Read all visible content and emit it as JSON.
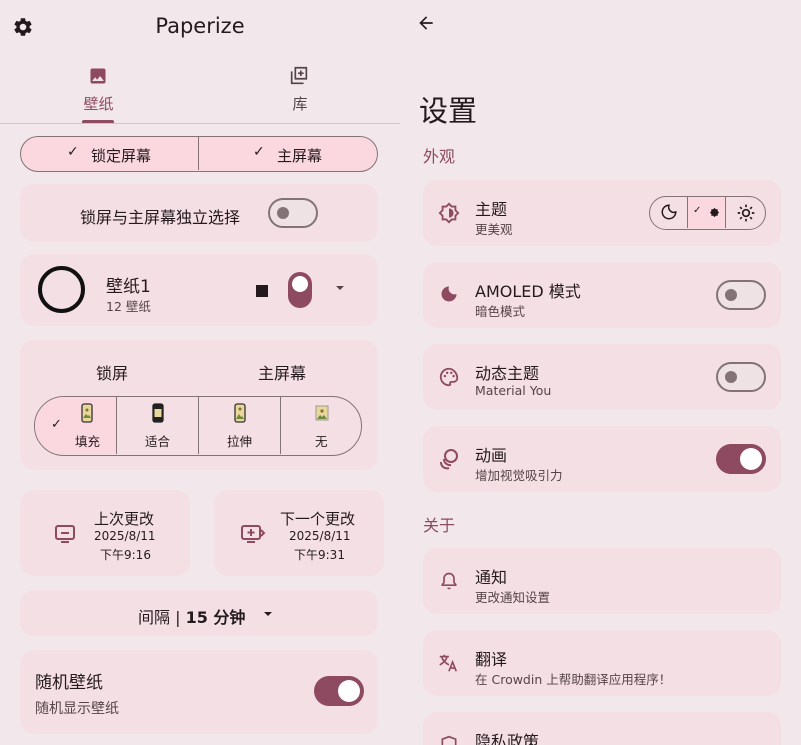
{
  "left": {
    "header": {
      "title": "Paperize",
      "settings_icon": "gear-icon"
    },
    "tabs": [
      {
        "label": "壁纸",
        "icon": "image-icon",
        "selected": true
      },
      {
        "label": "库",
        "icon": "library-add-icon",
        "selected": false
      }
    ],
    "screen_segment": [
      {
        "label": "锁定屏幕",
        "checked": true
      },
      {
        "label": "主屏幕",
        "checked": true
      }
    ],
    "independent": {
      "label": "锁屏与主屏幕独立选择",
      "on": false
    },
    "album": {
      "name": "壁纸1",
      "count": "12 壁纸"
    },
    "scaling": {
      "lock_label": "锁屏",
      "home_label": "主屏幕",
      "options": [
        {
          "label": "填充",
          "selected": true
        },
        {
          "label": "适合",
          "selected": false
        },
        {
          "label": "拉伸",
          "selected": false
        },
        {
          "label": "无",
          "selected": false
        }
      ]
    },
    "last_change": {
      "label": "上次更改",
      "date": "2025/8/11",
      "time": "下午9:16"
    },
    "next_change": {
      "label": "下一个更改",
      "date": "2025/8/11",
      "time": "下午9:31"
    },
    "interval": {
      "prefix": "间隔 | ",
      "value": "15 分钟"
    },
    "shuffle": {
      "title": "随机壁纸",
      "subtitle": "随机显示壁纸",
      "on": true
    }
  },
  "right": {
    "title": "设置",
    "sections": {
      "appearance": "外观",
      "about": "关于"
    },
    "theme": {
      "title": "主题",
      "subtitle": "更美观"
    },
    "amoled": {
      "title": "AMOLED 模式",
      "subtitle": "暗色模式",
      "on": false
    },
    "dynamic": {
      "title": "动态主题",
      "subtitle": "Material You",
      "on": false
    },
    "animation": {
      "title": "动画",
      "subtitle": "增加视觉吸引力",
      "on": true
    },
    "notification": {
      "title": "通知",
      "subtitle": "更改通知设置"
    },
    "translate": {
      "title": "翻译",
      "subtitle": "在 Crowdin 上帮助翻译应用程序！"
    },
    "privacy": {
      "title": "隐私政策"
    }
  },
  "colors": {
    "accent": "#8d4a60",
    "card": "#f4dfe4",
    "background": "#f2e7ea",
    "segment_selected": "#fbd8e0"
  }
}
